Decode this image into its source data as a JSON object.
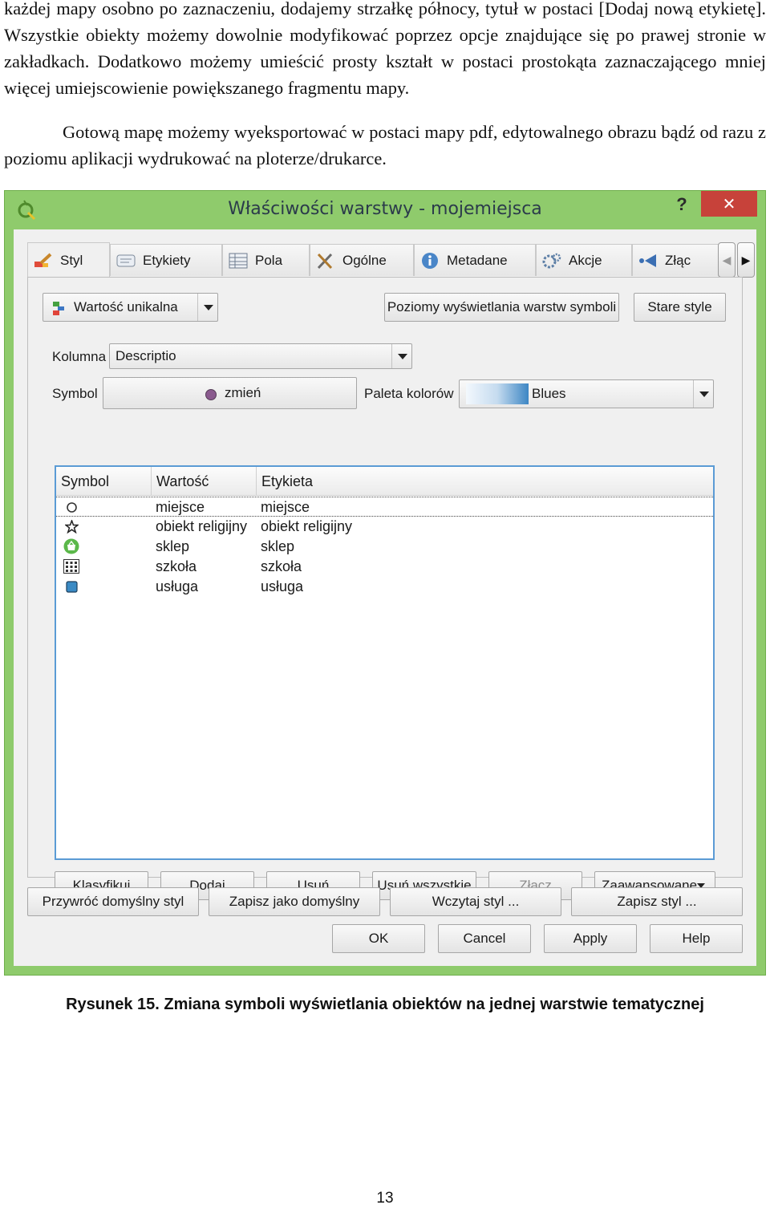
{
  "document": {
    "paragraph_1": "każdej mapy osobno po zaznaczeniu, dodajemy strzałkę północy, tytuł w postaci [Dodaj nową etykietę]. Wszystkie obiekty możemy dowolnie modyfikować poprzez opcje znajdujące się po prawej stronie w zakładkach. Dodatkowo możemy umieścić prosty kształt w postaci prostokąta zaznaczającego mniej więcej umiejscowienie powiększanego fragmentu mapy.",
    "paragraph_2": "Gotową mapę możemy wyeksportować w postaci mapy pdf, edytowalnego obrazu bądź od razu z poziomu aplikacji wydrukować na ploterze/drukarce.",
    "caption": "Rysunek 15. Zmiana symboli wyświetlania obiektów na jednej warstwie tematycznej",
    "page_number": "13"
  },
  "window": {
    "title": "Właściwości warstwy - mojemiejsca",
    "help": "?",
    "close": "✕",
    "title_bar_color": "#8fcb6c",
    "close_color": "#c7423a"
  },
  "tabs": [
    {
      "label": "Styl",
      "icon": "style-brush-icon",
      "active": true
    },
    {
      "label": "Etykiety",
      "icon": "labels-icon"
    },
    {
      "label": "Pola",
      "icon": "fields-table-icon"
    },
    {
      "label": "Ogólne",
      "icon": "tools-icon"
    },
    {
      "label": "Metadane",
      "icon": "info-icon"
    },
    {
      "label": "Akcje",
      "icon": "gears-icon"
    },
    {
      "label": "Złąc",
      "icon": "join-icon"
    }
  ],
  "renderer": {
    "type_value": "Wartość unikalna",
    "levels_button": "Poziomy wyświetlania warstw symboli",
    "old_style_button": "Stare style",
    "column_label": "Kolumna",
    "column_value": "Descriptio",
    "symbol_label": "Symbol",
    "symbol_change": "zmień",
    "palette_label": "Paleta kolorów",
    "palette_value": "Blues"
  },
  "table": {
    "headers": [
      "Symbol",
      "Wartość",
      "Etykieta"
    ],
    "rows": [
      {
        "symbol": "circle-outline-icon",
        "value": "miejsce",
        "label": "miejsce"
      },
      {
        "symbol": "star-icon",
        "value": "obiekt religijny",
        "label": "obiekt religijny"
      },
      {
        "symbol": "shop-basket-icon",
        "value": "sklep",
        "label": "sklep"
      },
      {
        "symbol": "school-building-icon",
        "value": "szkoła",
        "label": "szkoła"
      },
      {
        "symbol": "blue-square-icon",
        "value": "usługa",
        "label": "usługa"
      }
    ]
  },
  "table_buttons": {
    "classify": "Klasyfikuj",
    "add": "Dodaj",
    "remove": "Usuń",
    "remove_all": "Usuń wszystkie",
    "join": "Złącz",
    "advanced": "Zaawansowane"
  },
  "style_buttons": {
    "restore_default": "Przywróć domyślny styl",
    "save_default": "Zapisz jako domyślny",
    "load_style": "Wczytaj styl ...",
    "save_style": "Zapisz styl ..."
  },
  "dialog_buttons": {
    "ok": "OK",
    "cancel": "Cancel",
    "apply": "Apply",
    "help": "Help"
  }
}
